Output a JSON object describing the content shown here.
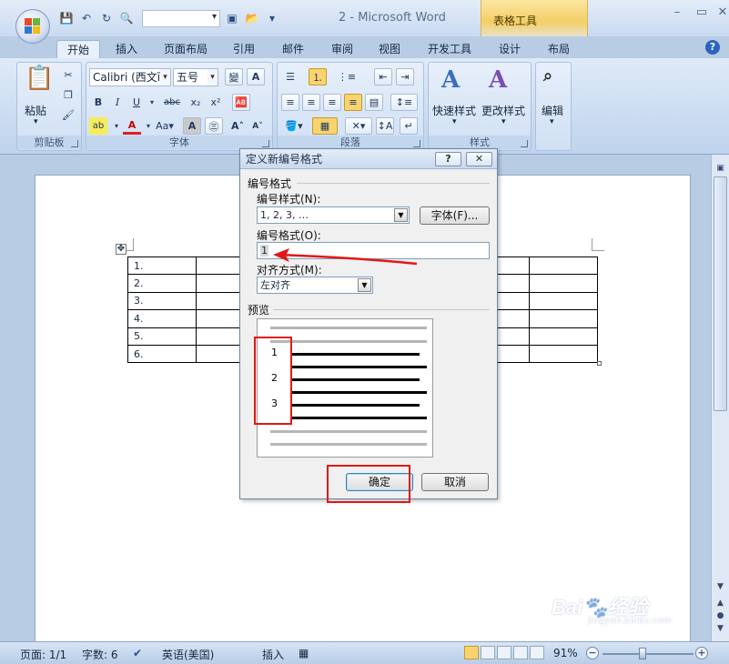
{
  "window": {
    "title": "2 - Microsoft Word",
    "context_tab": "表格工具"
  },
  "tabs": [
    "开始",
    "插入",
    "页面布局",
    "引用",
    "邮件",
    "审阅",
    "视图",
    "开发工具",
    "设计",
    "布局"
  ],
  "ribbon": {
    "clipboard": {
      "label": "剪贴板",
      "paste": "粘贴"
    },
    "font": {
      "label": "字体",
      "name": "Calibri (西文ī",
      "size": "五号",
      "change_case": "Aa"
    },
    "paragraph": {
      "label": "段落"
    },
    "styles": {
      "label": "样式",
      "quick": "快速样式",
      "change": "更改样式"
    },
    "editing": {
      "label": "编辑"
    }
  },
  "document": {
    "table_rows": [
      "1.",
      "2.",
      "3.",
      "4.",
      "5.",
      "6."
    ]
  },
  "dialog": {
    "title": "定义新编号格式",
    "section_format": "编号格式",
    "style_label": "编号样式(N):",
    "style_value": "1, 2, 3, …",
    "font_button": "字体(F)...",
    "format_label": "编号格式(O):",
    "format_value": "1",
    "align_label": "对齐方式(M):",
    "align_value": "左对齐",
    "preview_label": "预览",
    "preview_numbers": [
      "1",
      "2",
      "3"
    ],
    "ok": "确定",
    "cancel": "取消",
    "help_btn": "?",
    "close_btn": "✕"
  },
  "statusbar": {
    "page": "页面: 1/1",
    "words": "字数: 6",
    "language": "英语(美国)",
    "mode": "插入",
    "zoom": "91%"
  },
  "watermark": "Baidu 经验 jingyan.baidu.com",
  "colors": {
    "accent_red": "#e01818",
    "ribbon_blue": "#c8daf1",
    "context_gold": "#f3cf66"
  }
}
